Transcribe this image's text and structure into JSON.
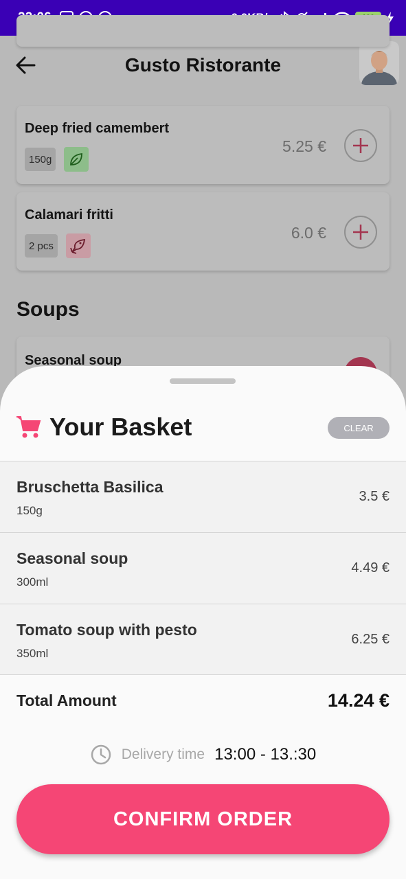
{
  "status_bar": {
    "time": "22:06",
    "network_speed": "0.0KB/s",
    "battery": "100",
    "icons": [
      "sigma-icon",
      "notification-icon",
      "notification-icon",
      "bluetooth-icon",
      "mute-icon",
      "signal-icon",
      "wifi-icon",
      "battery-icon",
      "charging-icon"
    ]
  },
  "header": {
    "title": "Gusto Ristorante",
    "back_icon": "arrow-left-icon",
    "avatar": "user-avatar"
  },
  "menu": {
    "items": [
      {
        "name": "Deep fried camembert",
        "quantity": "150g",
        "badge": "leaf-icon",
        "price": "5.25 €"
      },
      {
        "name": "Calamari fritti",
        "quantity": "2 pcs",
        "badge": "fish-icon",
        "price": "6.0 €"
      }
    ],
    "section_title": "Soups",
    "peek_item": {
      "name": "Seasonal soup"
    }
  },
  "basket": {
    "title": "Your Basket",
    "clear_label": "CLEAR",
    "items": [
      {
        "name": "Bruschetta Basilica",
        "quantity": "150g",
        "price": "3.5 €"
      },
      {
        "name": "Seasonal soup",
        "quantity": "300ml",
        "price": "4.49 €"
      },
      {
        "name": "Tomato soup with pesto",
        "quantity": "350ml",
        "price": "6.25 €"
      }
    ],
    "total_label": "Total Amount",
    "total_value": "14.24 €",
    "delivery_label": "Delivery time",
    "delivery_time": "13:00 - 13.:30",
    "confirm_label": "CONFIRM ORDER"
  },
  "colors": {
    "status_bar": "#3a00b5",
    "accent": "#f54675",
    "clear_button": "#b0b0b6",
    "veg_badge": "#8dbd8a",
    "fish_badge": "#c99ca4"
  }
}
